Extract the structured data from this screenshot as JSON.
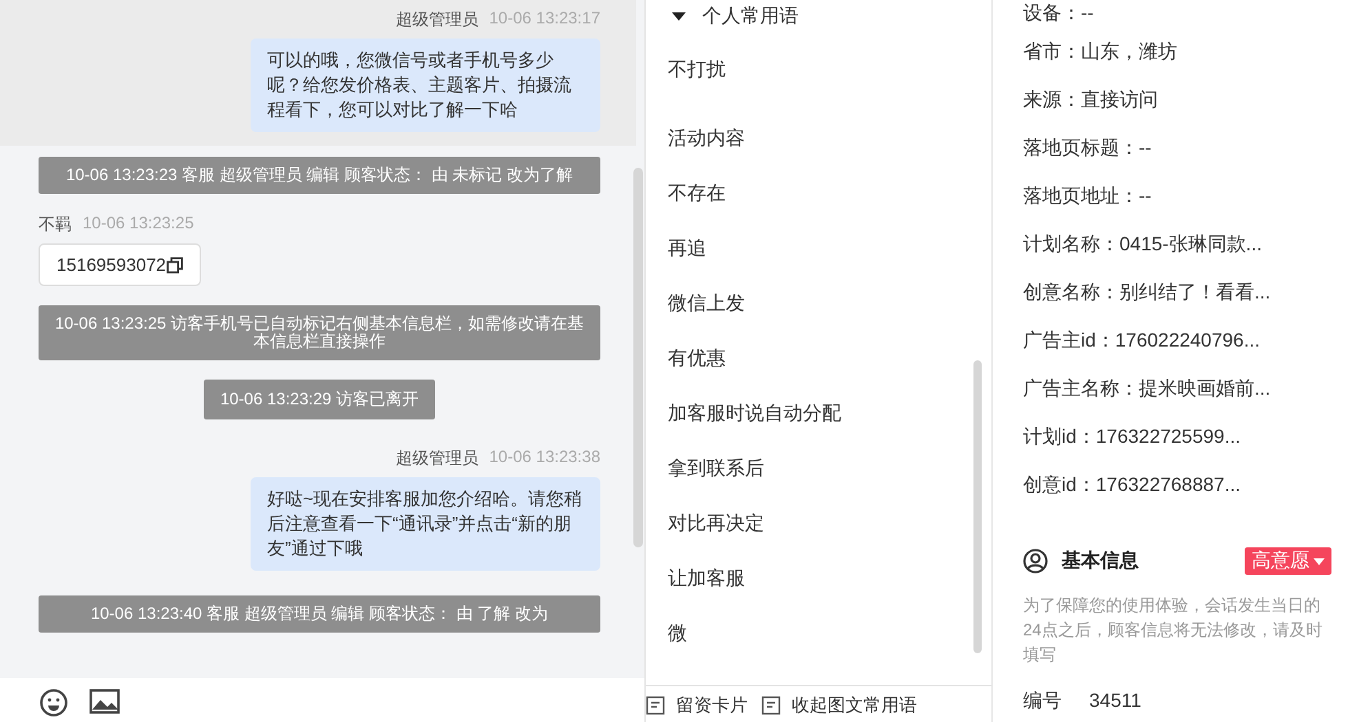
{
  "chat": {
    "messages": [
      {
        "kind": "agent",
        "name": "超级管理员",
        "time": "10-06 13:23:17",
        "text": "可以的哦，您微信号或者手机号多少呢？给您发价格表、主题客片、拍摄流程看下，您可以对比了解一下哈",
        "highlighted": true
      },
      {
        "kind": "system",
        "text": "10-06 13:23:23 客服 超级管理员 编辑 顾客状态： 由 未标记 改为了解"
      },
      {
        "kind": "visitor",
        "name": "不羁",
        "time": "10-06 13:23:25",
        "text": "15169593072"
      },
      {
        "kind": "system",
        "text": "10-06 13:23:25 访客手机号已自动标记右侧基本信息栏，如需修改请在基本信息栏直接操作"
      },
      {
        "kind": "system",
        "text": "10-06 13:23:29 访客已离开"
      },
      {
        "kind": "agent",
        "name": "超级管理员",
        "time": "10-06 13:23:38",
        "text": "好哒~现在安排客服加您介绍哈。请您稍后注意查看一下“通讯录”并点击“新的朋友”通过下哦",
        "highlighted": false
      },
      {
        "kind": "system",
        "text": "10-06 13:23:40 客服 超级管理员 编辑 顾客状态： 由 了解 改为"
      }
    ]
  },
  "phrases": {
    "group": {
      "label": "个人常用语",
      "expanded": true
    },
    "items": [
      "不打扰",
      "活动内容",
      "不存在",
      "再追",
      "微信上发",
      "有优惠",
      "加客服时说自动分配",
      "拿到联系后",
      "对比再决定",
      "让加客服",
      "微"
    ],
    "footer": [
      "留资卡片",
      "收起图文常用语"
    ]
  },
  "info": {
    "rows": [
      "设备：--",
      "省市：山东，潍坊",
      "来源：直接访问",
      "落地页标题：--",
      "落地页地址：--",
      "计划名称：0415-张琳同款...",
      "创意名称：别纠结了！看看...",
      "广告主id：176022240796...",
      "广告主名称：提米映画婚前...",
      "计划id：176322725599...",
      "创意id：176322768887..."
    ],
    "section": {
      "title": "基本信息",
      "tag": "高意愿",
      "note": "为了保障您的使用体验，会话发生当日的24点之后，顾客信息将无法修改，请及时填写"
    },
    "fields": [
      {
        "label": "编号",
        "value": "34511"
      }
    ]
  }
}
